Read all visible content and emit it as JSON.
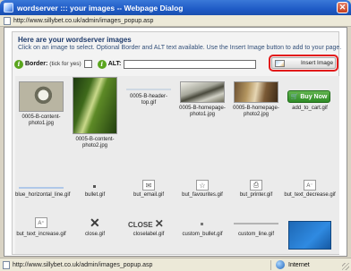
{
  "window": {
    "title": "wordserver ::: your images -- Webpage Dialog",
    "url": "http://www.sillybet.co.uk/admin/images_popup.asp"
  },
  "header": {
    "title": "Here are your wordserver images",
    "instructions": "Click on an image to select. Optional Border and ALT text available. Use the Insert Image button to add to your page."
  },
  "toolbar": {
    "border_label": "Border:",
    "border_hint": "(tick for yes)",
    "alt_label": "ALT:",
    "alt_value": "",
    "insert_label": "Insert Image"
  },
  "images": [
    {
      "name": "0005-B-content-photo1.jpg",
      "icon": "bird-photo"
    },
    {
      "name": "0005-B-content-photo2.jpg",
      "icon": "leaf-photo"
    },
    {
      "name": "0005-B-header-top.gif",
      "icon": "header-strip"
    },
    {
      "name": "0005-B-homepage-photo1.jpg",
      "icon": "tree-photo"
    },
    {
      "name": "0005-B-homepage-photo2.jpg",
      "icon": "bark-photo"
    },
    {
      "name": "add_to_cart.gif",
      "icon": "buy-now-button",
      "button_text": "Buy Now"
    },
    {
      "name": "blue_horizontal_line.gif",
      "icon": "horizontal-line"
    },
    {
      "name": "bullet.gif",
      "icon": "bullet"
    },
    {
      "name": "but_email.gif",
      "icon": "email-button"
    },
    {
      "name": "but_favourites.gif",
      "icon": "star-button"
    },
    {
      "name": "but_printer.gif",
      "icon": "printer-button"
    },
    {
      "name": "but_text_decrease.gif",
      "icon": "text-decrease-button"
    },
    {
      "name": "but_text_increase.gif",
      "icon": "text-increase-button"
    },
    {
      "name": "close.gif",
      "icon": "close-x"
    },
    {
      "name": "closelabel.gif",
      "icon": "close-label",
      "button_text": "CLOSE"
    },
    {
      "name": "custom_bullet.gif",
      "icon": "custom-bullet"
    },
    {
      "name": "custom_line.gif",
      "icon": "custom-line"
    },
    {
      "name": "",
      "icon": "blue-square"
    }
  ],
  "status": {
    "url": "http://www.sillybet.co.uk/admin/images_popup.asp",
    "zone": "Internet"
  },
  "colors": {
    "title_bar": "#1f5bc6",
    "highlight": "#e21a1a",
    "buy_now": "#3f9a32",
    "heading": "#1f3b6b"
  }
}
